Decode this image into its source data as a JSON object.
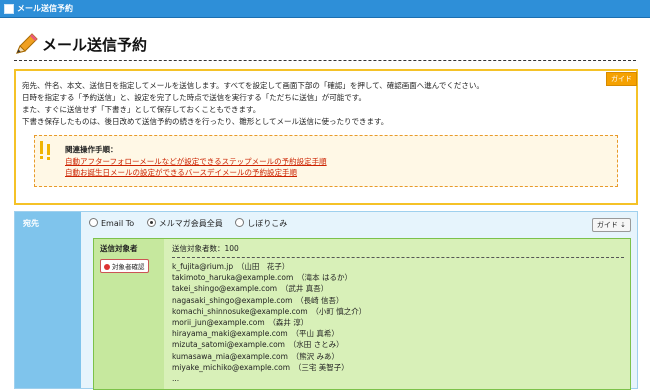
{
  "window": {
    "title": "メール送信予約"
  },
  "page": {
    "heading": "メール送信予約"
  },
  "guide": {
    "badge": "ガイド",
    "lines": [
      "宛先、件名、本文、送信日を指定してメールを送信します。すべてを設定して画面下部の「確認」を押して、確認画面へ進んでください。",
      "日時を指定する「予約送信」と、設定を完了した時点で送信を実行する「ただちに送信」が可能です。",
      "また、すぐに送信せず「下書き」として保存しておくこともできます。",
      "下書き保存したものは、後日改めて送信予約の続きを行ったり、雛形としてメール送信に使ったりできます。"
    ],
    "tip": {
      "title": "関連操作手順：",
      "links": [
        "自動アフターフォローメールなどが設定できるステップメールの予約設定手順",
        "自動お誕生日メールの設定ができるバースデイメールの予約設定手順"
      ]
    }
  },
  "address": {
    "label": "宛先",
    "options": [
      "Email To",
      "メルマガ会員全員",
      "しぼりこみ"
    ],
    "selected_index": 1,
    "guide_button": "ガイド",
    "target": {
      "label": "送信対象者",
      "confirm_button": "対象者確認",
      "count_text": "送信対象者数：100",
      "recipients": [
        "k_fujita@rium.jp　（山田　花子）",
        "takimoto_haruka@example.com　（滝本 はるか）",
        "takei_shingo@example.com　（武井 真吾）",
        "nagasaki_shingo@example.com　（長崎 信吾）",
        "komachi_shinnosuke@example.com　（小町 慎之介）",
        "morii_jun@example.com　（森井 淳）",
        "hirayama_maki@example.com　（平山 真希）",
        "mizuta_satomi@example.com　（水田 さとみ）",
        "kumasawa_mia@example.com　（熊沢 みあ）",
        "miyake_michiko@example.com　（三宅 美智子）",
        "..."
      ]
    }
  },
  "colors": {
    "titlebar": "#2e8fd8",
    "guide_border": "#f5c227",
    "link": "#cc2200",
    "target_bg": "#d8f0b8"
  }
}
